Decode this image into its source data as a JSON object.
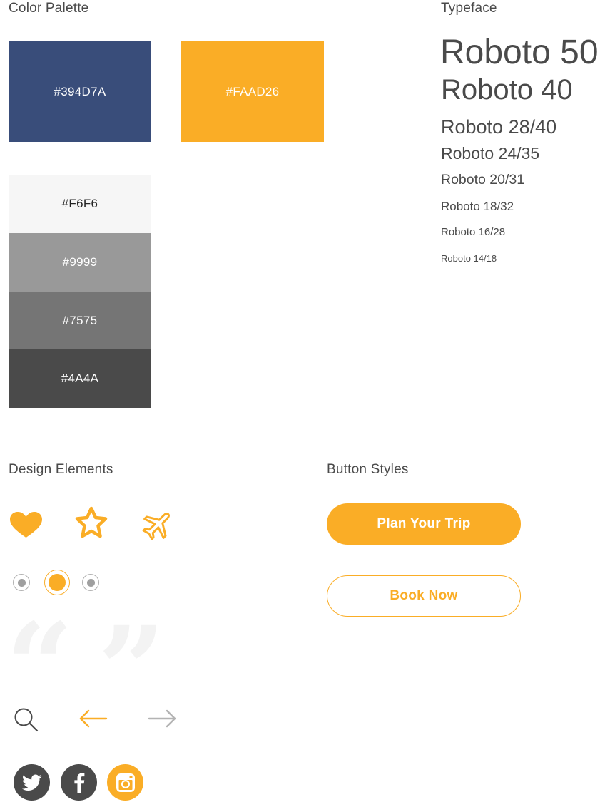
{
  "sections": {
    "color_palette": "Color Palette",
    "typeface": "Typeface",
    "design_elements": "Design Elements",
    "button_styles": "Button Styles"
  },
  "colors": {
    "primary": {
      "hex": "#394D7A",
      "value": "#394D7A"
    },
    "accent": {
      "hex": "#FAAD26",
      "value": "#FAAD26"
    },
    "grays": [
      {
        "hex": "#F6F6",
        "value": "#F6F6F6"
      },
      {
        "hex": "#9999",
        "value": "#999999"
      },
      {
        "hex": "#7575",
        "value": "#757575"
      },
      {
        "hex": "#4A4A",
        "value": "#4A4A4A"
      }
    ]
  },
  "typeface": {
    "samples": [
      "Roboto 50",
      "Roboto 40",
      "Roboto 28/40",
      "Roboto 24/35",
      "Roboto 20/31",
      "Roboto 18/32",
      "Roboto 16/28",
      "Roboto 14/18"
    ]
  },
  "design_elements": {
    "icons": [
      "heart-icon",
      "star-icon",
      "airplane-icon"
    ],
    "radios": [
      "unselected",
      "selected",
      "unselected"
    ],
    "quote_marks": {
      "open": "“",
      "close": "”"
    },
    "nav_icons": [
      "search-icon",
      "arrow-left-icon",
      "arrow-right-icon"
    ],
    "social": [
      {
        "name": "twitter",
        "color": "#4A4A4A"
      },
      {
        "name": "facebook",
        "color": "#4A4A4A"
      },
      {
        "name": "instagram",
        "color": "#FAAD26"
      }
    ]
  },
  "buttons": {
    "primary_label": "Plan Your Trip",
    "secondary_label": "Book Now"
  }
}
